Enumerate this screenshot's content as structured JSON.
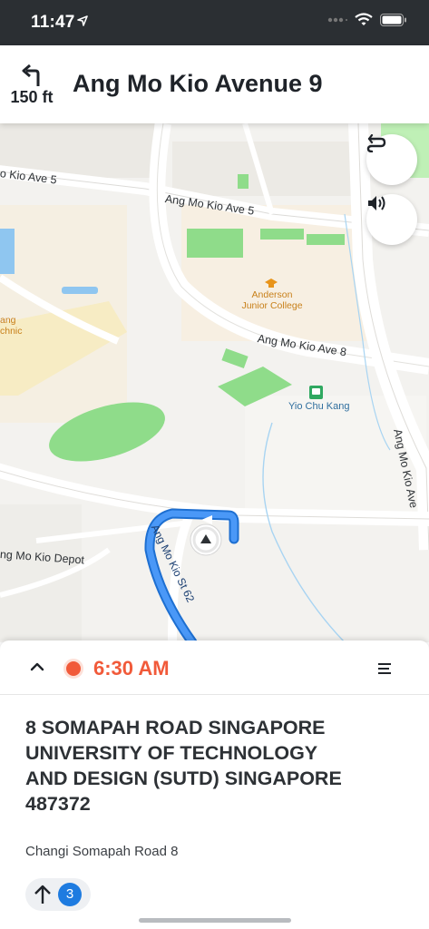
{
  "status_bar": {
    "time": "11:47"
  },
  "nav": {
    "turn_distance": "150 ft",
    "street_name": "Ang Mo Kio Avenue 9"
  },
  "map": {
    "labels": {
      "ave5_left": "o Kio Ave 5",
      "ave5_center": "Ang Mo Kio Ave 5",
      "ave8": "Ang Mo Kio Ave 8",
      "ave_right": "Ang Mo Kio Ave",
      "st62": "Ang Mo Kio St 62",
      "depot": "ng Mo Kio Depot",
      "school_left": "ang\nchnic",
      "college": "Anderson\nJunior College",
      "station": "Yio Chu Kang"
    },
    "colors": {
      "route": "#3f8ef7",
      "park": "#8fdc8a",
      "road": "#ffffff",
      "land": "#f3f2ef"
    }
  },
  "buttons": {
    "route_options_icon": "route-options-icon",
    "sound_icon": "speaker-icon"
  },
  "sheet": {
    "eta": "6:30 AM",
    "address": "8 SOMAPAH ROAD SINGAPORE UNIVERSITY OF TECHNOLOGY AND DESIGN (SUTD) SINGAPORE 487372",
    "sub_address": "Changi Somapah Road 8",
    "steps_count": "3"
  }
}
